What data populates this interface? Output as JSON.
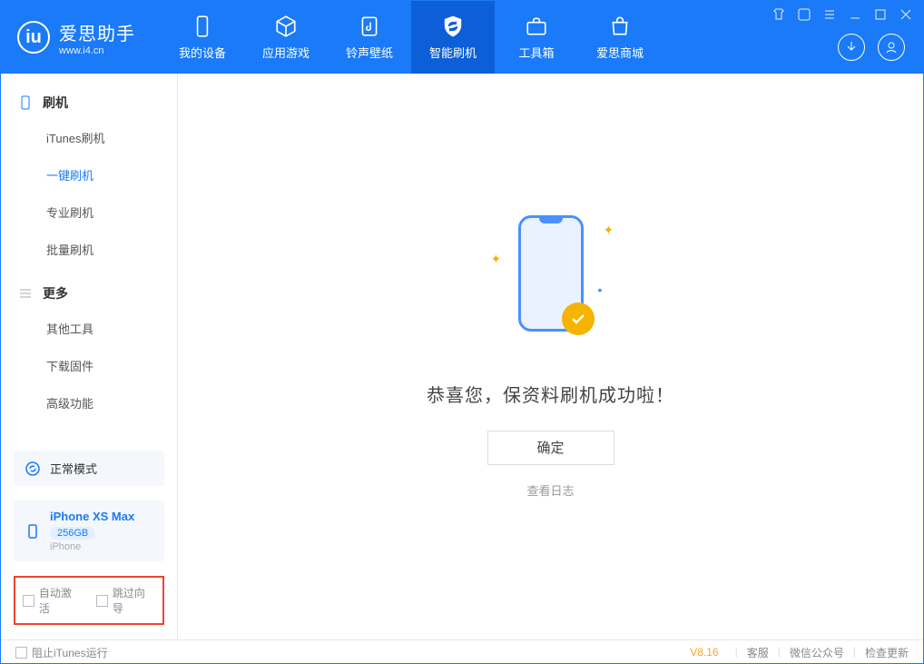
{
  "app": {
    "name": "爱思助手",
    "url": "www.i4.cn"
  },
  "nav": {
    "my_device": "我的设备",
    "apps_games": "应用游戏",
    "ringtone_wallpaper": "铃声壁纸",
    "smart_flash": "智能刷机",
    "toolbox": "工具箱",
    "store": "爱思商城"
  },
  "sidebar": {
    "section_flash": "刷机",
    "items_flash": {
      "itunes": "iTunes刷机",
      "onekey": "一键刷机",
      "pro": "专业刷机",
      "batch": "批量刷机"
    },
    "section_more": "更多",
    "items_more": {
      "other_tools": "其他工具",
      "download_fw": "下载固件",
      "advanced": "高级功能"
    },
    "mode_label": "正常模式",
    "device": {
      "name": "iPhone XS Max",
      "capacity": "256GB",
      "type": "iPhone"
    },
    "checkbox_auto_activate": "自动激活",
    "checkbox_skip_wizard": "跳过向导"
  },
  "main": {
    "title": "恭喜您，保资料刷机成功啦！",
    "ok": "确定",
    "log_link": "查看日志"
  },
  "footer": {
    "block_itunes": "阻止iTunes运行",
    "version": "V8.16",
    "support": "客服",
    "wechat": "微信公众号",
    "update": "检查更新"
  }
}
